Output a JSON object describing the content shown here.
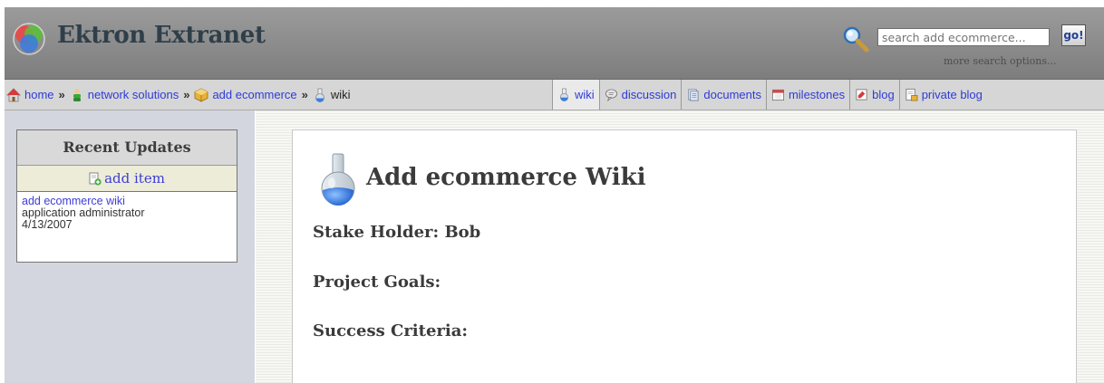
{
  "header": {
    "title": "Ektron Extranet",
    "search_placeholder": "search add ecommerce...",
    "go_label": "go!",
    "more_search_label": "more search options..."
  },
  "breadcrumb": {
    "home": "home",
    "network_solutions": "network solutions",
    "add_ecommerce": "add ecommerce",
    "current": "wiki",
    "separator": "»"
  },
  "tabs": {
    "wiki": "wiki",
    "discussion": "discussion",
    "documents": "documents",
    "milestones": "milestones",
    "blog": "blog",
    "private_blog": "private blog"
  },
  "sidebar": {
    "recent_updates_title": "Recent Updates",
    "add_item_label": "add item",
    "update": {
      "title": "add ecommerce wiki",
      "author": "application administrator",
      "date": "4/13/2007"
    }
  },
  "main": {
    "title": "Add ecommerce Wiki",
    "stake_holder": "Stake Holder: Bob",
    "project_goals": "Project Goals:",
    "success_criteria": "Success Criteria:"
  },
  "colors": {
    "link_blue": "#2e3bd6",
    "header_gray": "#8b8b8b",
    "sidebar_bg": "#d3d6df"
  },
  "icons": {
    "logo": "ektron-logo-icon",
    "search": "magnifier-icon",
    "home": "home-icon",
    "network": "group-icon",
    "project": "box-icon",
    "wiki": "flask-icon",
    "discussion": "speech-bubble-icon",
    "documents": "document-icon",
    "milestones": "calendar-icon",
    "blog": "blog-icon",
    "private_blog": "private-blog-icon",
    "add_item": "add-document-icon"
  }
}
